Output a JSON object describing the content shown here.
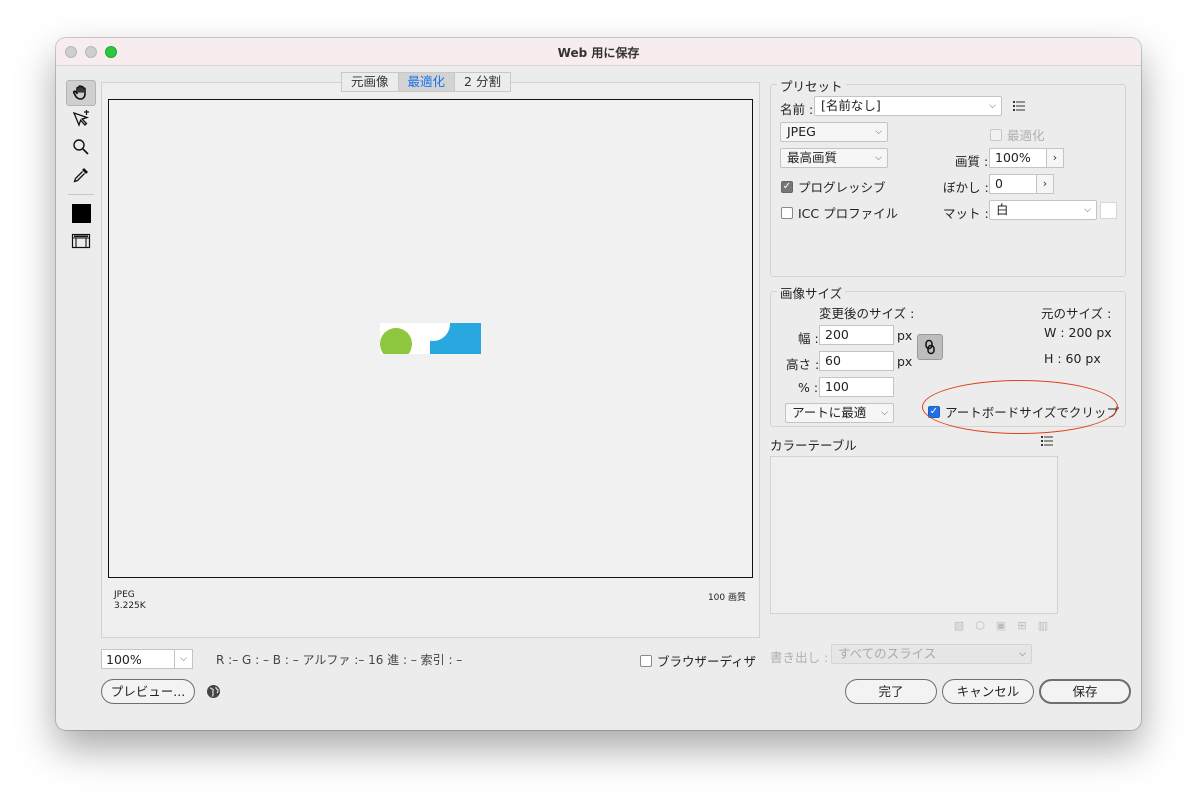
{
  "window": {
    "title": "Web 用に保存"
  },
  "toolbar": {
    "tools": [
      "hand-tool-icon",
      "slice-select-tool-icon",
      "zoom-tool-icon",
      "eyedropper-tool-icon",
      "eyedropper-color-swatch",
      "toggle-slices-icon"
    ]
  },
  "preview": {
    "tabs": [
      "元画像",
      "最適化",
      "2 分割"
    ],
    "active_tab": "最適化",
    "format_label": "JPEG",
    "file_size": "3.225K",
    "quality_label": "100 画質",
    "zoom": "100%",
    "readout": "R :–  G : –  B : –  アルファ :–  16 進 : –  索引 : –",
    "browser_dither_label": "ブラウザーディザ"
  },
  "preset": {
    "group_title": "プリセット",
    "name_label": "名前 :",
    "name_value": "[名前なし]",
    "format_value": "JPEG",
    "optimize_label": "最適化",
    "quality_preset_value": "最高画質",
    "quality_label": "画質 :",
    "quality_value": "100%",
    "progressive_label": "プログレッシブ",
    "progressive_checked": true,
    "blur_label": "ぼかし :",
    "blur_value": "0",
    "icc_label": "ICC プロファイル",
    "icc_checked": false,
    "matte_label": "マット :",
    "matte_value": "白"
  },
  "image_size": {
    "group_title": "画像サイズ",
    "new_size_label": "変更後のサイズ :",
    "width_label": "幅 :",
    "width_value": "200",
    "height_label": "高さ :",
    "height_value": "60",
    "percent_label": "% :",
    "percent_value": "100",
    "unit": "px",
    "resample_value": "アートに最適",
    "original_size_label": "元のサイズ :",
    "original_w": "W :  200 px",
    "original_h": "H :   60 px",
    "clip_artboard_label": "アートボードサイズでクリップ",
    "clip_artboard_checked": true
  },
  "color_table": {
    "title": "カラーテーブル"
  },
  "export": {
    "label": "書き出し :",
    "value": "すべてのスライス"
  },
  "buttons": {
    "preview": "プレビュー...",
    "done": "完了",
    "cancel": "キャンセル",
    "save": "保存"
  },
  "colors": {
    "accent_blue": "#1a73e8",
    "art_green": "#8dc63f",
    "art_blue": "#29a8e0",
    "annotation_red": "#e0401e"
  }
}
